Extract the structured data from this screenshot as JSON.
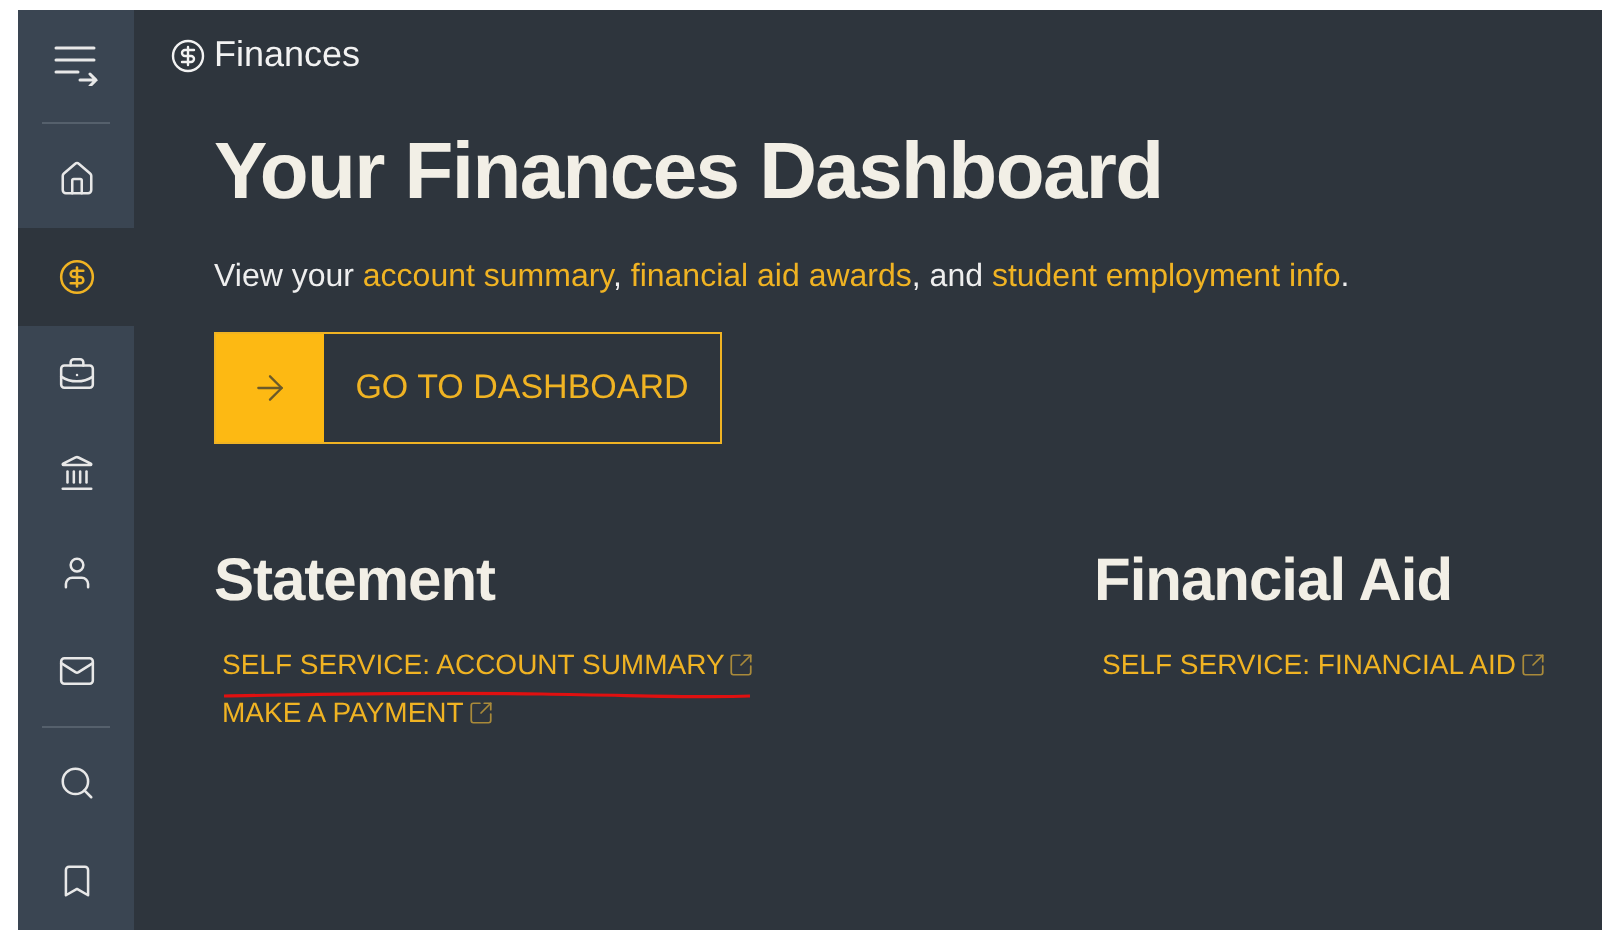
{
  "sidebar": {
    "items": [
      {
        "kind": "menu",
        "selected": false
      },
      {
        "kind": "divider"
      },
      {
        "kind": "home",
        "selected": false
      },
      {
        "kind": "finances",
        "selected": true
      },
      {
        "kind": "briefcase",
        "selected": false
      },
      {
        "kind": "bank",
        "selected": false
      },
      {
        "kind": "person",
        "selected": false
      },
      {
        "kind": "mail",
        "selected": false
      },
      {
        "kind": "divider"
      },
      {
        "kind": "search",
        "selected": false
      },
      {
        "kind": "bookmark",
        "selected": false
      }
    ]
  },
  "header": {
    "title": "Finances"
  },
  "hero": {
    "title": "Your Finances Dashboard",
    "intro": [
      {
        "text": "View your ",
        "link": false
      },
      {
        "text": "account summary",
        "link": true
      },
      {
        "text": ", ",
        "link": false
      },
      {
        "text": "financial aid awards",
        "link": true
      },
      {
        "text": ", and ",
        "link": false
      },
      {
        "text": "student employment info",
        "link": true
      },
      {
        "text": ".",
        "link": false
      }
    ],
    "button": "GO TO DASHBOARD"
  },
  "sections": [
    {
      "title": "Statement",
      "links": [
        {
          "label": "SELF SERVICE: ACCOUNT SUMMARY",
          "underlined": true
        },
        {
          "label": "MAKE A PAYMENT",
          "underlined": false
        }
      ]
    },
    {
      "title": "Financial Aid",
      "links": [
        {
          "label": "SELF SERVICE: FINANCIAL AID",
          "underlined": false
        }
      ]
    }
  ]
}
